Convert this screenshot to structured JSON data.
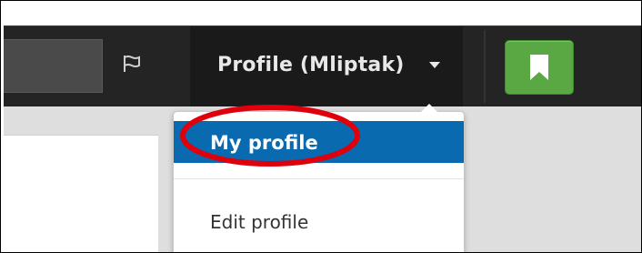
{
  "navbar": {
    "profile_label": "Profile (Mliptak)",
    "icons": {
      "flag": "flag-icon",
      "caret": "caret-down-icon",
      "bookmark": "bookmark-icon"
    },
    "colors": {
      "navbar_bg": "#242424",
      "bookmark_green": "#5aa844"
    }
  },
  "dropdown": {
    "items": [
      {
        "label": "My profile",
        "active": true
      },
      {
        "label": "Edit profile",
        "active": false
      }
    ],
    "active_color": "#0a6ab0"
  },
  "annotation": {
    "color": "#e0000b"
  }
}
